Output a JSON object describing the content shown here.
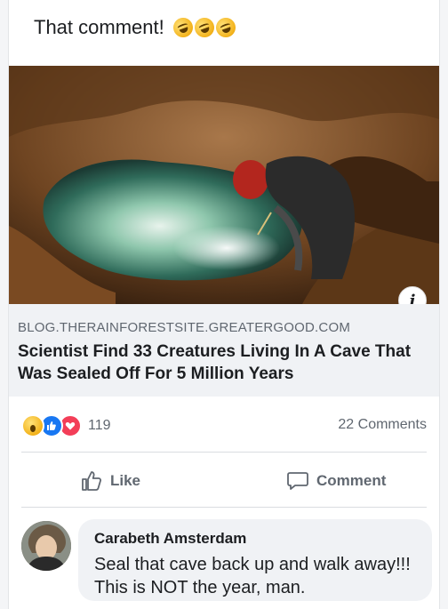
{
  "post": {
    "text": "That comment!",
    "emoji": [
      "rofl-emoji",
      "rofl-emoji",
      "rofl-emoji"
    ]
  },
  "link": {
    "domain": "BLOG.THERAINFORESTSITE.GREATERGOOD.COM",
    "title": "Scientist Find 33 Creatures Living In A Cave That Was Sealed Off For 5 Million Years",
    "info_icon": "info-icon"
  },
  "engagement": {
    "reactions": [
      "wow",
      "like",
      "love"
    ],
    "reaction_count": "119",
    "comments_count": "22 Comments"
  },
  "actions": {
    "like_label": "Like",
    "comment_label": "Comment"
  },
  "comment": {
    "author": "Carabeth Amsterdam",
    "text": "Seal that cave back up and walk away!!! This is NOT the year, man."
  },
  "colors": {
    "like_blue": "#1877f2",
    "love_red": "#f33e58",
    "muted_text": "#606770",
    "link_bg": "#f0f2f5"
  }
}
